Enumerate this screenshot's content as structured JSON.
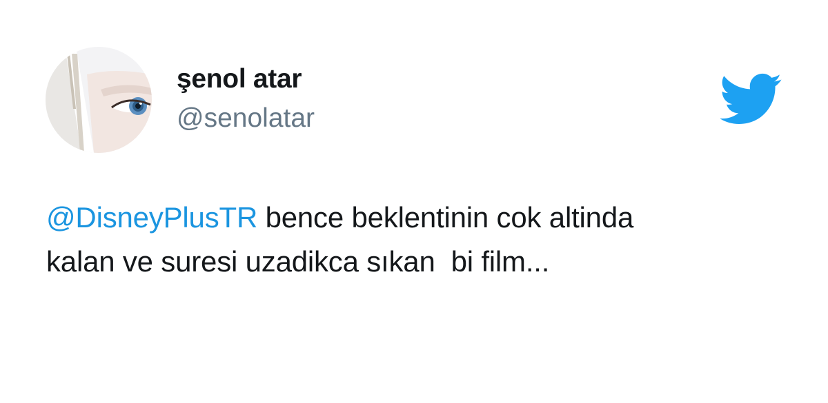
{
  "author": {
    "display_name": "şenol atar",
    "handle": "@senolatar",
    "avatar_icon": "profile-photo-eye"
  },
  "brand": {
    "icon": "twitter-bird-icon",
    "color": "#1da1f2"
  },
  "tweet": {
    "mention": "@DisneyPlusTR",
    "line1_rest": " bence beklentinin cok altinda",
    "line2": "kalan ve suresi uzadikca sıkan  bi film..."
  },
  "colors": {
    "mention": "#1b95e0",
    "text": "#14171a",
    "handle": "#657786"
  }
}
